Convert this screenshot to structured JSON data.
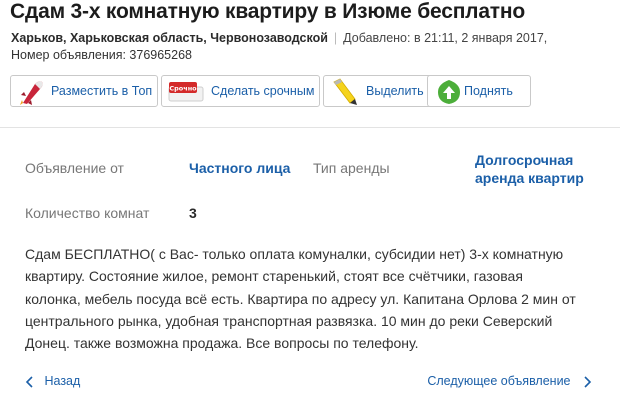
{
  "listing": {
    "title": "Сдам 3-х комнатную квартиру в Изюме бесплатно",
    "location": "Харьков, Харьковская область, Червонозаводской",
    "added": "Добавлено: в 21:11, 2 января 2017,",
    "ad_number": "Номер объявления: 376965268"
  },
  "actions": {
    "top_label": "Разместить в Топ",
    "urgent_label": "Сделать срочным",
    "urgent_badge": "Срочно",
    "highlight_label": "Выделить",
    "raise_label": "Поднять"
  },
  "properties": {
    "offer_from_label": "Объявление от",
    "offer_from_value": "Частного лица",
    "rent_type_label": "Тип аренды",
    "rent_type_value_line1": "Долгосрочная",
    "rent_type_value_line2": "аренда квартир",
    "rooms_label": "Количество комнат",
    "rooms_value": "3"
  },
  "description": {
    "lines": [
      "Сдам БЕСПЛАТНО( с Вас- только оплата комуналки, субсидии нет) 3-х комнатную",
      "квартиру. Состояние жилое, ремонт старенький, стоят все счётчики, газовая",
      "колонка, мебель посуда всё есть. Квартира по адресу ул. Капитана Орлова 2 мин от",
      "центрального рынка, удобная транспортная развязка. 10 мин до реки Северский",
      "Донец. также возможна продажа. Все вопросы по телефону."
    ]
  },
  "navigation": {
    "back_label": "Назад",
    "next_label": "Следующее объявление"
  },
  "colors": {
    "link": "#1b5fa8",
    "rocket_red": "#c8253a",
    "highlight_yellow": "#f5d31c",
    "raise_green": "#4cae3a"
  }
}
